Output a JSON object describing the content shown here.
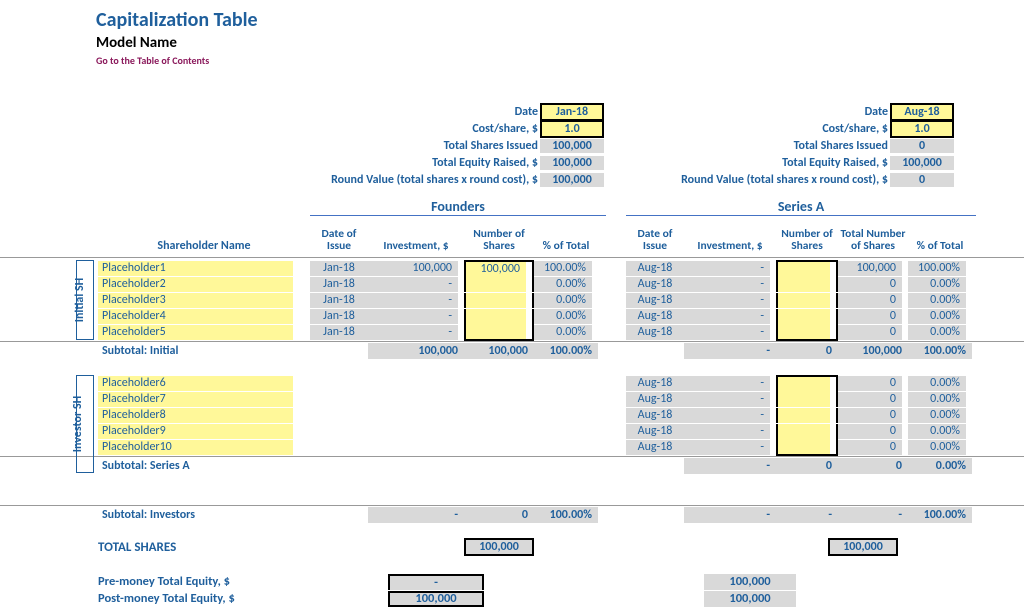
{
  "header": {
    "title": "Capitalization Table",
    "model_name": "Model Name",
    "toc_link": "Go to the Table of Contents"
  },
  "summary_labels": {
    "date": "Date",
    "cost_share": "Cost/share, $",
    "total_shares": "Total Shares Issued",
    "total_equity": "Total Equity Raised, $",
    "round_value": "Round Value (total shares x round cost), $"
  },
  "founders_summary": {
    "date": "Jan-18",
    "cost": "1.0",
    "shares": "100,000",
    "equity": "100,000",
    "round": "100,000"
  },
  "seriesa_summary": {
    "date": "Aug-18",
    "cost": "1.0",
    "shares": "0",
    "equity": "100,000",
    "round": "0"
  },
  "sections": {
    "founders": "Founders",
    "seriesa": "Series A"
  },
  "col_headers": {
    "shareholder": "Shareholder Name",
    "date": "Date of Issue",
    "investment": "Investment, $",
    "num_shares": "Number of Shares",
    "pct": "% of Total",
    "total_num": "Total Number of Shares"
  },
  "vert_labels": {
    "initial": "Initial SH",
    "investor": "Investor SH"
  },
  "initial_rows": [
    {
      "name": "Placeholder1",
      "f_date": "Jan-18",
      "f_inv": "100,000",
      "f_num": "100,000",
      "f_pct": "100.00%",
      "s_date": "Aug-18",
      "s_inv": "-",
      "s_num": "",
      "s_tot": "100,000",
      "s_pct": "100.00%"
    },
    {
      "name": "Placeholder2",
      "f_date": "Jan-18",
      "f_inv": "-",
      "f_num": "",
      "f_pct": "0.00%",
      "s_date": "Aug-18",
      "s_inv": "-",
      "s_num": "",
      "s_tot": "0",
      "s_pct": "0.00%"
    },
    {
      "name": "Placeholder3",
      "f_date": "Jan-18",
      "f_inv": "-",
      "f_num": "",
      "f_pct": "0.00%",
      "s_date": "Aug-18",
      "s_inv": "-",
      "s_num": "",
      "s_tot": "0",
      "s_pct": "0.00%"
    },
    {
      "name": "Placeholder4",
      "f_date": "Jan-18",
      "f_inv": "-",
      "f_num": "",
      "f_pct": "0.00%",
      "s_date": "Aug-18",
      "s_inv": "-",
      "s_num": "",
      "s_tot": "0",
      "s_pct": "0.00%"
    },
    {
      "name": "Placeholder5",
      "f_date": "Jan-18",
      "f_inv": "-",
      "f_num": "",
      "f_pct": "0.00%",
      "s_date": "Aug-18",
      "s_inv": "-",
      "s_num": "",
      "s_tot": "0",
      "s_pct": "0.00%"
    }
  ],
  "subtotal_initial": {
    "label": "Subtotal: Initial",
    "f_inv": "100,000",
    "f_num": "100,000",
    "f_pct": "100.00%",
    "s_inv": "-",
    "s_num": "0",
    "s_tot": "100,000",
    "s_pct": "100.00%"
  },
  "investor_rows": [
    {
      "name": "Placeholder6",
      "s_date": "Aug-18",
      "s_inv": "-",
      "s_num": "",
      "s_tot": "0",
      "s_pct": "0.00%"
    },
    {
      "name": "Placeholder7",
      "s_date": "Aug-18",
      "s_inv": "-",
      "s_num": "",
      "s_tot": "0",
      "s_pct": "0.00%"
    },
    {
      "name": "Placeholder8",
      "s_date": "Aug-18",
      "s_inv": "-",
      "s_num": "",
      "s_tot": "0",
      "s_pct": "0.00%"
    },
    {
      "name": "Placeholder9",
      "s_date": "Aug-18",
      "s_inv": "-",
      "s_num": "",
      "s_tot": "0",
      "s_pct": "0.00%"
    },
    {
      "name": "Placeholder10",
      "s_date": "Aug-18",
      "s_inv": "-",
      "s_num": "",
      "s_tot": "0",
      "s_pct": "0.00%"
    }
  ],
  "subtotal_seriesa": {
    "label": "Subtotal: Series A",
    "s_inv": "-",
    "s_num": "0",
    "s_tot": "0",
    "s_pct": "0.00%"
  },
  "subtotal_investors": {
    "label": "Subtotal: Investors",
    "f_inv": "-",
    "f_num": "0",
    "f_pct": "100.00%",
    "s_inv": "-",
    "s_num": "-",
    "s_tot": "-",
    "s_pct": "100.00%"
  },
  "totals": {
    "total_shares_label": "TOTAL SHARES",
    "founders_total": "100,000",
    "seriesa_total": "100,000",
    "pre_label": "Pre-money Total Equity, $",
    "post_label": "Post-money Total Equity, $",
    "pre_f": "-",
    "post_f": "100,000",
    "pre_s": "100,000",
    "post_s": "100,000"
  }
}
